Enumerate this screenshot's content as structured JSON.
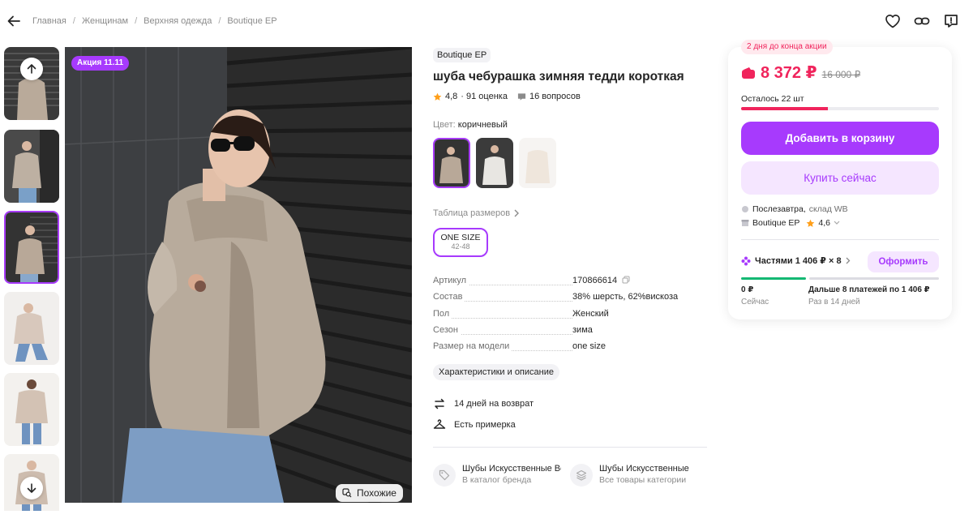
{
  "breadcrumbs": [
    "Главная",
    "Женщинам",
    "Верхняя одежда",
    "Boutique EP"
  ],
  "icons": {
    "back": "arrow-left-icon",
    "favorite": "heart-icon",
    "share": "link-icon",
    "report": "report-icon"
  },
  "gallery": {
    "promo_badge": "Акция 11.11",
    "similar_label": "Похожие",
    "thumb_count": 6,
    "active_thumb": 3
  },
  "product": {
    "brand": "Boutique EP",
    "title": "шуба чебурашка зимняя тедди короткая",
    "rating": "4,8",
    "reviews": "· 91 оценка",
    "questions": "16 вопросов",
    "color_label": "Цвет:",
    "color_value": "коричневый",
    "size_table_label": "Таблица размеров",
    "size": {
      "name": "ONE SIZE",
      "range": "42-48"
    },
    "specs": [
      {
        "key": "Артикул",
        "value": "170866614"
      },
      {
        "key": "Состав",
        "value": "38% шерсть, 62%вискоза"
      },
      {
        "key": "Пол",
        "value": "Женский"
      },
      {
        "key": "Сезон",
        "value": "зима"
      },
      {
        "key": "Размер на модели",
        "value": "one size"
      }
    ],
    "chars_button": "Характеристики и описание",
    "features": [
      "14 дней на возврат",
      "Есть примерка"
    ],
    "category_links": [
      {
        "title": "Шубы Искусственные Во",
        "subtitle": "В каталог бренда"
      },
      {
        "title": "Шубы Искусственные",
        "subtitle": "Все товары категории"
      }
    ]
  },
  "buy_card": {
    "timer": "2 дня до конца акции",
    "price": "8 372 ₽",
    "old_price": "16 000 ₽",
    "stock_label": "Осталось 22 шт",
    "stock_fraction": 0.44,
    "add_to_cart": "Добавить в корзину",
    "buy_now": "Купить сейчас",
    "delivery": "Послезавтра,",
    "warehouse": "склад WB",
    "seller": "Boutique EP",
    "seller_rating": "4,6",
    "installments": "Частями 1 406 ₽ × 8",
    "checkout": "Оформить",
    "pay_now_amount": "0 ₽",
    "pay_now_label": "Сейчас",
    "pay_later_amount": "Дальше 8 платежей по 1 406 ₽",
    "pay_later_label": "Раз в 14 дней"
  },
  "colors": {
    "accent": "#a73afd",
    "price": "#f0245c",
    "success": "#14b873"
  }
}
